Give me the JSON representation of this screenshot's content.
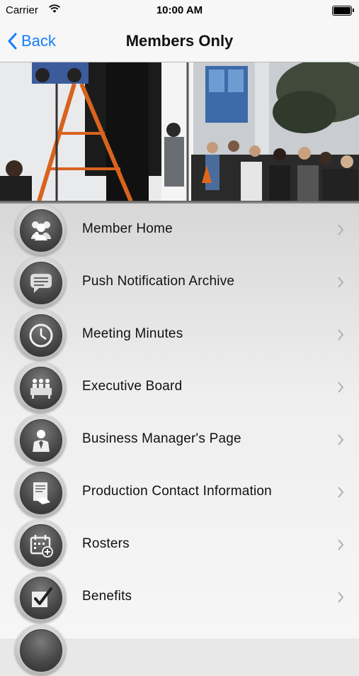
{
  "status_bar": {
    "carrier": "Carrier",
    "time": "10:00 AM"
  },
  "nav": {
    "back_label": "Back",
    "title": "Members Only"
  },
  "menu": [
    {
      "label": "Member Home",
      "icon": "members-group-icon"
    },
    {
      "label": "Push Notification Archive",
      "icon": "speech-bubble-icon"
    },
    {
      "label": "Meeting Minutes",
      "icon": "clock-icon"
    },
    {
      "label": "Executive Board",
      "icon": "board-panel-icon"
    },
    {
      "label": "Business Manager's Page",
      "icon": "businessman-icon"
    },
    {
      "label": "Production Contact Information",
      "icon": "document-handshake-icon"
    },
    {
      "label": "Rosters",
      "icon": "calendar-icon"
    },
    {
      "label": "Benefits",
      "icon": "checkbox-icon"
    },
    {
      "label": "",
      "icon": "more-icon"
    }
  ],
  "colors": {
    "accent": "#147efb",
    "icon_dark": "#3e3e3e",
    "chevron": "#b0b0b0"
  }
}
